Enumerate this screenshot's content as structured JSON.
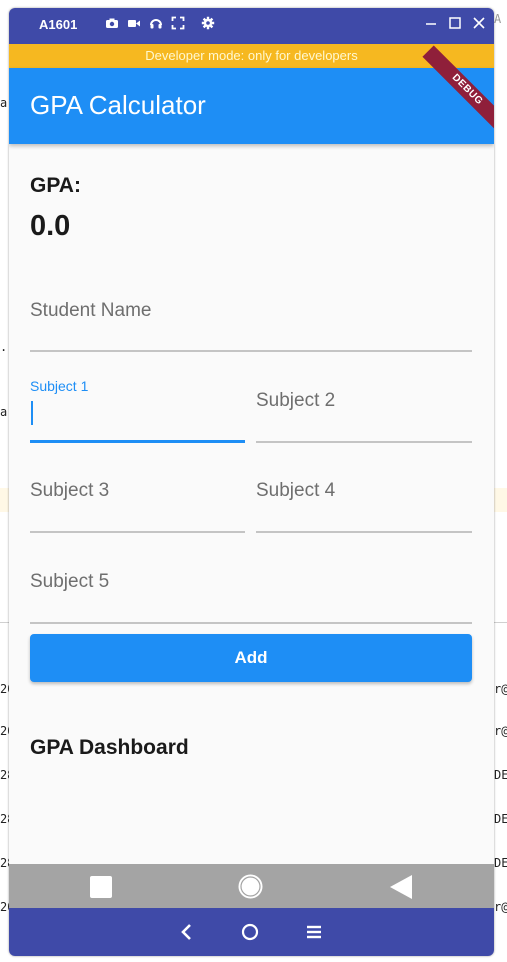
{
  "emulator": {
    "device_title": "A1601",
    "tool_icons": [
      "camera-icon",
      "video-icon",
      "headset-icon",
      "fullscreen-icon",
      "gear-icon"
    ],
    "window_icons": [
      "minimize-icon",
      "maximize-icon",
      "close-icon"
    ]
  },
  "dev_banner": "Developer mode: only for developers",
  "debug_ribbon": "DEBUG",
  "app": {
    "title": "GPA Calculator",
    "gpa_label": "GPA:",
    "gpa_value": "0.0",
    "fields": {
      "student_name": {
        "placeholder": "Student Name",
        "value": ""
      },
      "subject1": {
        "label": "Subject 1",
        "value": ""
      },
      "subject2": {
        "placeholder": "Subject 2",
        "value": ""
      },
      "subject3": {
        "placeholder": "Subject 3",
        "value": ""
      },
      "subject4": {
        "placeholder": "Subject 4",
        "value": ""
      },
      "subject5": {
        "placeholder": "Subject 5",
        "value": ""
      }
    },
    "add_button": "Add",
    "dashboard_title": "GPA Dashboard"
  },
  "android_nav": {
    "icons": [
      "square-icon",
      "circle-icon",
      "triangle-back-icon"
    ]
  },
  "emulator_nav": {
    "icons": [
      "chevron-left-icon",
      "circle-home-icon",
      "menu-icon"
    ]
  },
  "background_ide": {
    "left_fragments": [
      "a",
      ".:",
      "a",
      "20",
      "20",
      "28",
      "28",
      "28",
      "20"
    ],
    "right_fragments": [
      "A",
      "r@",
      "r@",
      "DE",
      "DE",
      "DE",
      "r@"
    ]
  },
  "colors": {
    "primary": "#1e8ef5",
    "emulator_chrome": "#3f4aa8",
    "dev_banner": "#f6b820",
    "debug_ribbon": "#8f1f3a",
    "android_nav": "#a4a4a4"
  }
}
